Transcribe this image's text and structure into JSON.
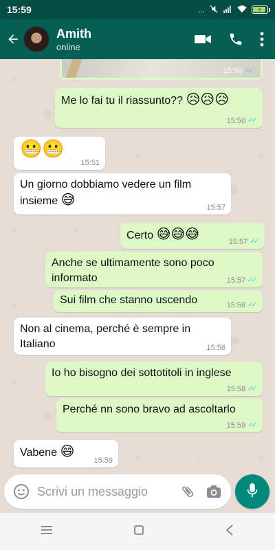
{
  "status_bar": {
    "time": "15:59",
    "icons_text": "...",
    "battery_color": "#a9d46b",
    "battery_level": 0.8
  },
  "header": {
    "contact_name": "Amith",
    "contact_status": "online",
    "bg_color": "#075e54",
    "actions": [
      "video-call-icon",
      "phone-icon",
      "more-vert-icon"
    ]
  },
  "messages": [
    {
      "dir": "out",
      "type": "image",
      "time": "15:50",
      "read": true
    },
    {
      "dir": "out",
      "text": "Me lo fai tu il riassunto??",
      "emoji": "😥😥😥",
      "time": "15:50",
      "read": true
    },
    {
      "dir": "in",
      "text": "",
      "emoji": "😬😬",
      "time": "15:51"
    },
    {
      "dir": "in",
      "text": "Un giorno dobbiamo vedere un film",
      "text2": "insieme",
      "emoji": "😅",
      "time": "15:57"
    },
    {
      "dir": "out",
      "text": "Certo",
      "emoji": "😅😅😅",
      "time": "15:57",
      "read": true
    },
    {
      "dir": "out",
      "text": "Anche se ultimamente sono poco",
      "text2": "informato",
      "time": "15:57",
      "read": true
    },
    {
      "dir": "out",
      "text": "Sui film che stanno uscendo",
      "time": "15:58",
      "read": true
    },
    {
      "dir": "in",
      "text": "Non al cinema, perché è sempre in",
      "text2": "Italiano",
      "time": "15:58"
    },
    {
      "dir": "out",
      "text": "Io ho bisogno dei sottotitoli in inglese",
      "time": "15:58",
      "read": true
    },
    {
      "dir": "out",
      "text": "Perché nn sono bravo ad ascoltarlo",
      "time": "15:59",
      "read": true
    },
    {
      "dir": "in",
      "text": "Vabene",
      "emoji": "😄",
      "time": "15:59"
    }
  ],
  "input": {
    "placeholder": "Scrivi un messaggio",
    "emoji_icon": "emoji-icon",
    "attach_icon": "paperclip-icon",
    "camera_icon": "camera-icon",
    "mic_icon": "mic-icon",
    "accent": "#00897b"
  },
  "colors": {
    "outgoing_bubble": "#dcf8c6",
    "incoming_bubble": "#ffffff",
    "chat_bg": "#e5ddd5",
    "read_ticks": "#4fc3f7"
  },
  "nav": [
    "menu-icon",
    "home-square-icon",
    "back-triangle-icon"
  ]
}
